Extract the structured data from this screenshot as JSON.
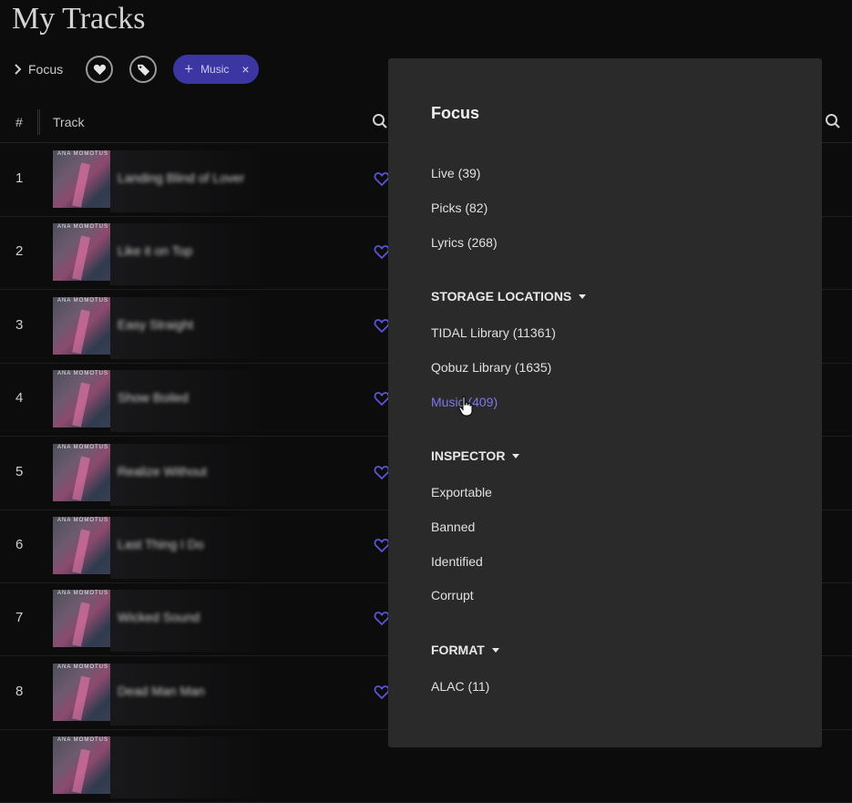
{
  "page": {
    "title": "My Tracks"
  },
  "toolbar": {
    "focus_label": "Focus",
    "filter_chip": {
      "label": "Music",
      "remove_symbol": "×",
      "add_symbol": "+"
    }
  },
  "table": {
    "headers": {
      "number": "#",
      "track": "Track"
    },
    "rows": [
      {
        "num": "1",
        "title": "Landing Blind of Lover",
        "album_art_text": "ANA MOMOTUS"
      },
      {
        "num": "2",
        "title": "Like it on Top",
        "album_art_text": "ANA MOMOTUS"
      },
      {
        "num": "3",
        "title": "Easy Straight",
        "album_art_text": "ANA MOMOTUS"
      },
      {
        "num": "4",
        "title": "Show Boiled",
        "album_art_text": "ANA MOMOTUS"
      },
      {
        "num": "5",
        "title": "Realize Without",
        "album_art_text": "ANA MOMOTUS"
      },
      {
        "num": "6",
        "title": "Last Thing I Do",
        "album_art_text": "ANA MOMOTUS"
      },
      {
        "num": "7",
        "title": "Wicked Sound",
        "album_art_text": "ANA MOMOTUS"
      },
      {
        "num": "8",
        "title": "Dead Man Man",
        "album_art_text": "ANA MOMOTUS"
      },
      {
        "num": "",
        "title": "",
        "album_art_text": "ANA MOMOTUS"
      }
    ]
  },
  "focus_panel": {
    "title": "Focus",
    "items": [
      "Live (39)",
      "Picks (82)",
      "Lyrics (268)"
    ],
    "storage_locations": {
      "header": "STORAGE LOCATIONS",
      "items": [
        "TIDAL Library (11361)",
        "Qobuz Library (1635)",
        "Music (409)"
      ]
    },
    "inspector": {
      "header": "INSPECTOR",
      "items": [
        "Exportable",
        "Banned",
        "Identified",
        "Corrupt"
      ]
    },
    "format": {
      "header": "FORMAT",
      "items": [
        "ALAC (11)"
      ]
    }
  },
  "colors": {
    "accent": "#3c36a3",
    "active_text": "#7d79e6",
    "panel_bg": "#2a2a2b",
    "page_bg": "#0c0c0d"
  },
  "icons": [
    "chevron-right-icon",
    "heart-icon",
    "tag-icon",
    "plus-icon",
    "close-icon",
    "search-icon",
    "heart-outline-icon",
    "caret-down-icon",
    "hand-cursor-icon"
  ]
}
